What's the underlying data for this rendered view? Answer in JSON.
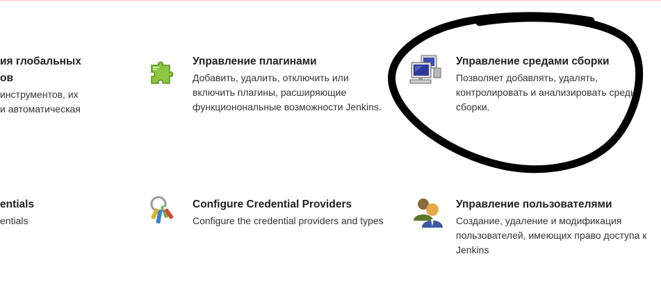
{
  "items": [
    {
      "title_line1": "ия глобальных",
      "title_line2": "ов",
      "desc_line1": "инструментов, их",
      "desc_line2": "и автоматическая"
    },
    {
      "title": "Управление плагинами",
      "desc_line1": "Добавить, удалить, отключить или",
      "desc_line2": "включить плагины, расширяющие",
      "desc_line3": "функционональные возможности Jenkins."
    },
    {
      "title": "Управление средами сборки",
      "desc_line1": "Позволяет добавлять, удалять,",
      "desc_line2": "контролировать и анализировать среды",
      "desc_line3": "сборки."
    },
    {
      "title": "entials",
      "desc": "entials"
    },
    {
      "title": "Configure Credential Providers",
      "desc": "Configure the credential providers and types"
    },
    {
      "title": "Управление пользователями",
      "desc_line1": "Создание, удаление и модификация",
      "desc_line2": "пользователей, имеющих право доступа к",
      "desc_line3": "Jenkins"
    }
  ],
  "icons": [
    "puzzle-piece-icon",
    "computer-nodes-icon",
    "keys-icon",
    "users-icon"
  ],
  "colors": {
    "title": "#222222",
    "text": "#333333",
    "top_border": "#f2c4c4",
    "annotation": "#000000"
  }
}
